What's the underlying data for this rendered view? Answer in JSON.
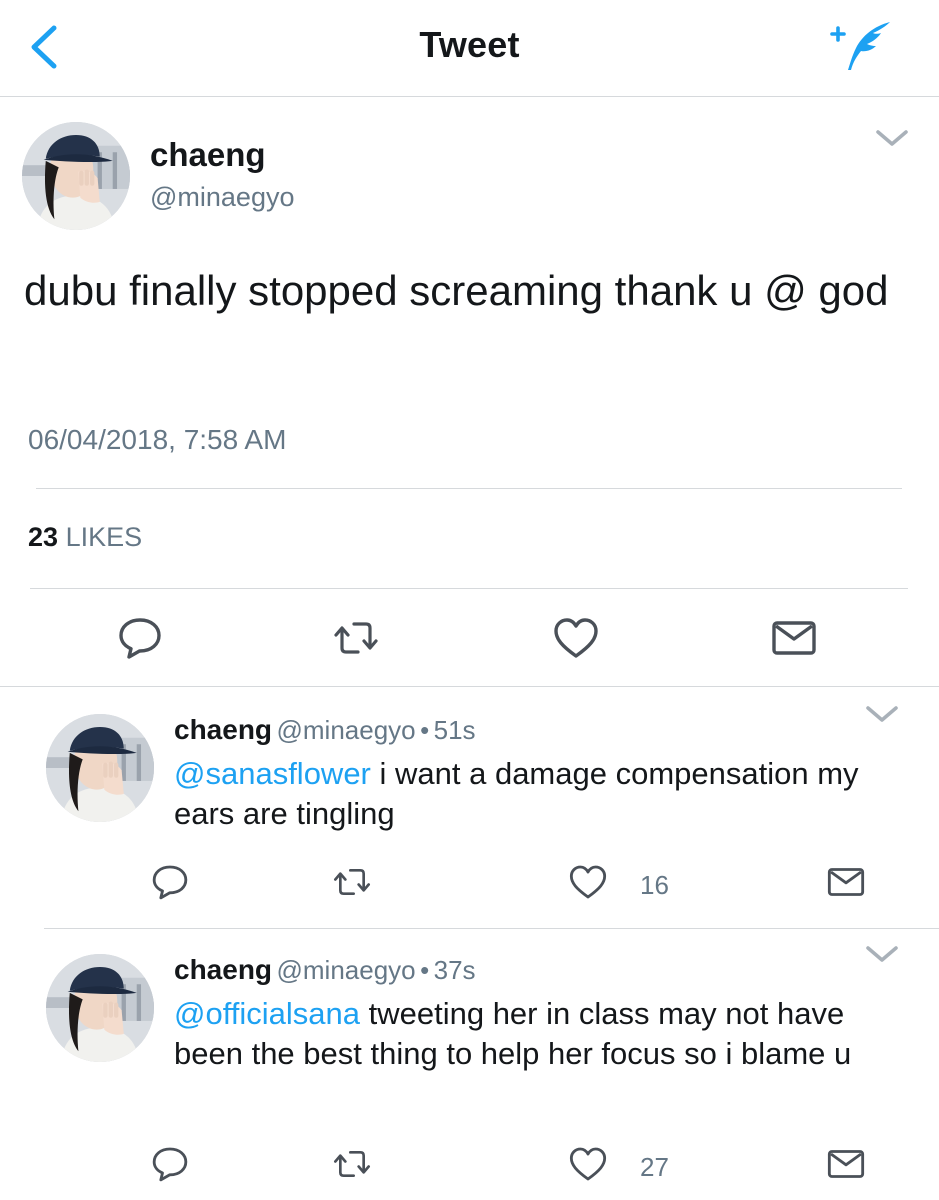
{
  "header": {
    "title": "Tweet",
    "back_icon": "chevron-left-icon",
    "compose_icon": "compose-feather-icon",
    "accent_color": "#1da1f2"
  },
  "main_tweet": {
    "display_name": "chaeng",
    "handle": "@minaegyo",
    "text": "dubu finally stopped screaming thank u @ god",
    "timestamp": "06/04/2018, 7:58 AM",
    "likes_count": "23",
    "likes_label": "LIKES",
    "actions": [
      "reply-icon",
      "retweet-icon",
      "like-icon",
      "message-icon"
    ]
  },
  "replies": [
    {
      "display_name": "chaeng",
      "handle": "@minaegyo",
      "separator": "•",
      "time": "51s",
      "mention": "@sanasflower",
      "text": " i want a damage compensation my ears are tingling",
      "like_count": "16"
    },
    {
      "display_name": "chaeng",
      "handle": "@minaegyo",
      "separator": "•",
      "time": "37s",
      "mention": "@officialsana",
      "text": " tweeting her in class may not have been the best thing to help her focus so i blame u",
      "like_count": "27"
    }
  ]
}
